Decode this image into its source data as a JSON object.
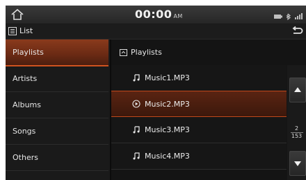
{
  "status": {
    "time": "00:00",
    "ampm": "AM"
  },
  "title": "List",
  "sidebar": {
    "items": [
      {
        "label": "Playlists",
        "active": true
      },
      {
        "label": "Artists",
        "active": false
      },
      {
        "label": "Albums",
        "active": false
      },
      {
        "label": "Songs",
        "active": false
      },
      {
        "label": "Others",
        "active": false
      }
    ]
  },
  "breadcrumb": {
    "label": "Playlists"
  },
  "tracks": [
    {
      "label": "Music1.MP3",
      "icon": "music-note-icon",
      "playing": false
    },
    {
      "label": "Music2.MP3",
      "icon": "play-circle-icon",
      "playing": true
    },
    {
      "label": "Music3.MP3",
      "icon": "music-note-icon",
      "playing": false
    },
    {
      "label": "Music4.MP3",
      "icon": "music-note-icon",
      "playing": false
    }
  ],
  "pager": {
    "current": "2",
    "total": "153"
  },
  "colors": {
    "accent": "#c2491b",
    "background": "#141414"
  }
}
